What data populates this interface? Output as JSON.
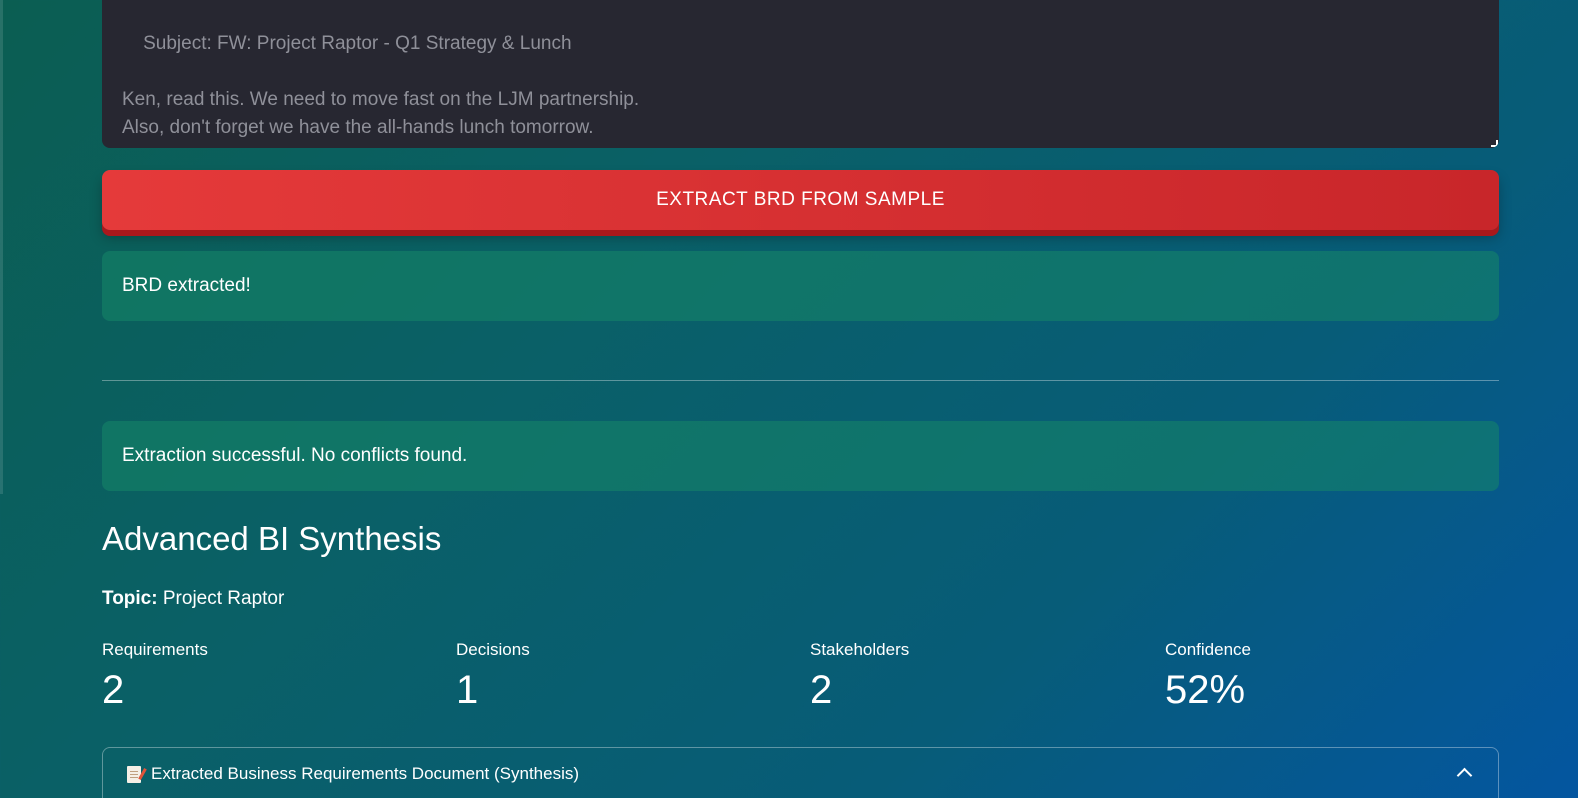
{
  "email_input": {
    "text": "Subject: FW: Project Raptor - Q1 Strategy & Lunch\n\nKen, read this. We need to move fast on the LJM partnership.\nAlso, don't forget we have the all-hands lunch tomorrow."
  },
  "extract_button": {
    "label": "EXTRACT BRD FROM SAMPLE"
  },
  "alerts": {
    "extracted": "BRD extracted!",
    "status": "Extraction successful. No conflicts found."
  },
  "synthesis": {
    "title": "Advanced BI Synthesis",
    "topic_label": "Topic:",
    "topic_value": "Project Raptor",
    "metrics": [
      {
        "label": "Requirements",
        "value": "2"
      },
      {
        "label": "Decisions",
        "value": "1"
      },
      {
        "label": "Stakeholders",
        "value": "2"
      },
      {
        "label": "Confidence",
        "value": "52%"
      }
    ]
  },
  "expander": {
    "icon": "document-pencil-icon",
    "label": "Extracted Business Requirements Document (Synthesis)",
    "state": "expanded"
  }
}
